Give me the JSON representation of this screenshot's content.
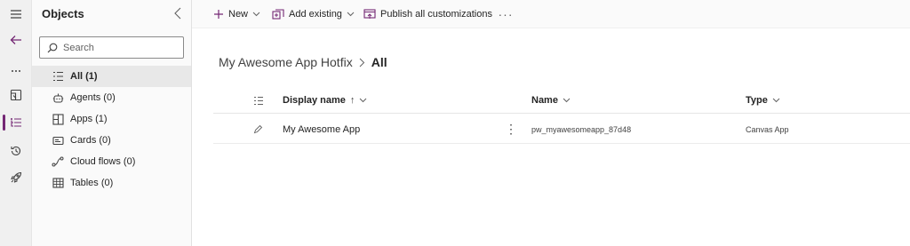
{
  "objects_panel": {
    "title": "Objects",
    "search_placeholder": "Search",
    "items": [
      {
        "label": "All (1)",
        "icon": "list-icon",
        "active": true
      },
      {
        "label": "Agents (0)",
        "icon": "bot-icon"
      },
      {
        "label": "Apps (1)",
        "icon": "apps-icon"
      },
      {
        "label": "Cards (0)",
        "icon": "card-icon"
      },
      {
        "label": "Cloud flows (0)",
        "icon": "flow-icon"
      },
      {
        "label": "Tables (0)",
        "icon": "table-icon"
      }
    ]
  },
  "commands": {
    "new_label": "New",
    "add_existing_label": "Add existing",
    "publish_label": "Publish all customizations",
    "more_label": "···"
  },
  "breadcrumb": {
    "parent": "My Awesome App Hotfix",
    "current": "All"
  },
  "table": {
    "columns": {
      "display_name": "Display name",
      "sort_arrow": "↑",
      "name": "Name",
      "type": "Type"
    },
    "rows": [
      {
        "display_name": "My Awesome App",
        "name": "pw_myawesomeapp_87d48",
        "type": "Canvas App",
        "more": "⋮"
      }
    ]
  },
  "colors": {
    "accent": "#742774",
    "panel_bg": "#fafafa",
    "rail_bg": "#f0f0f0"
  }
}
